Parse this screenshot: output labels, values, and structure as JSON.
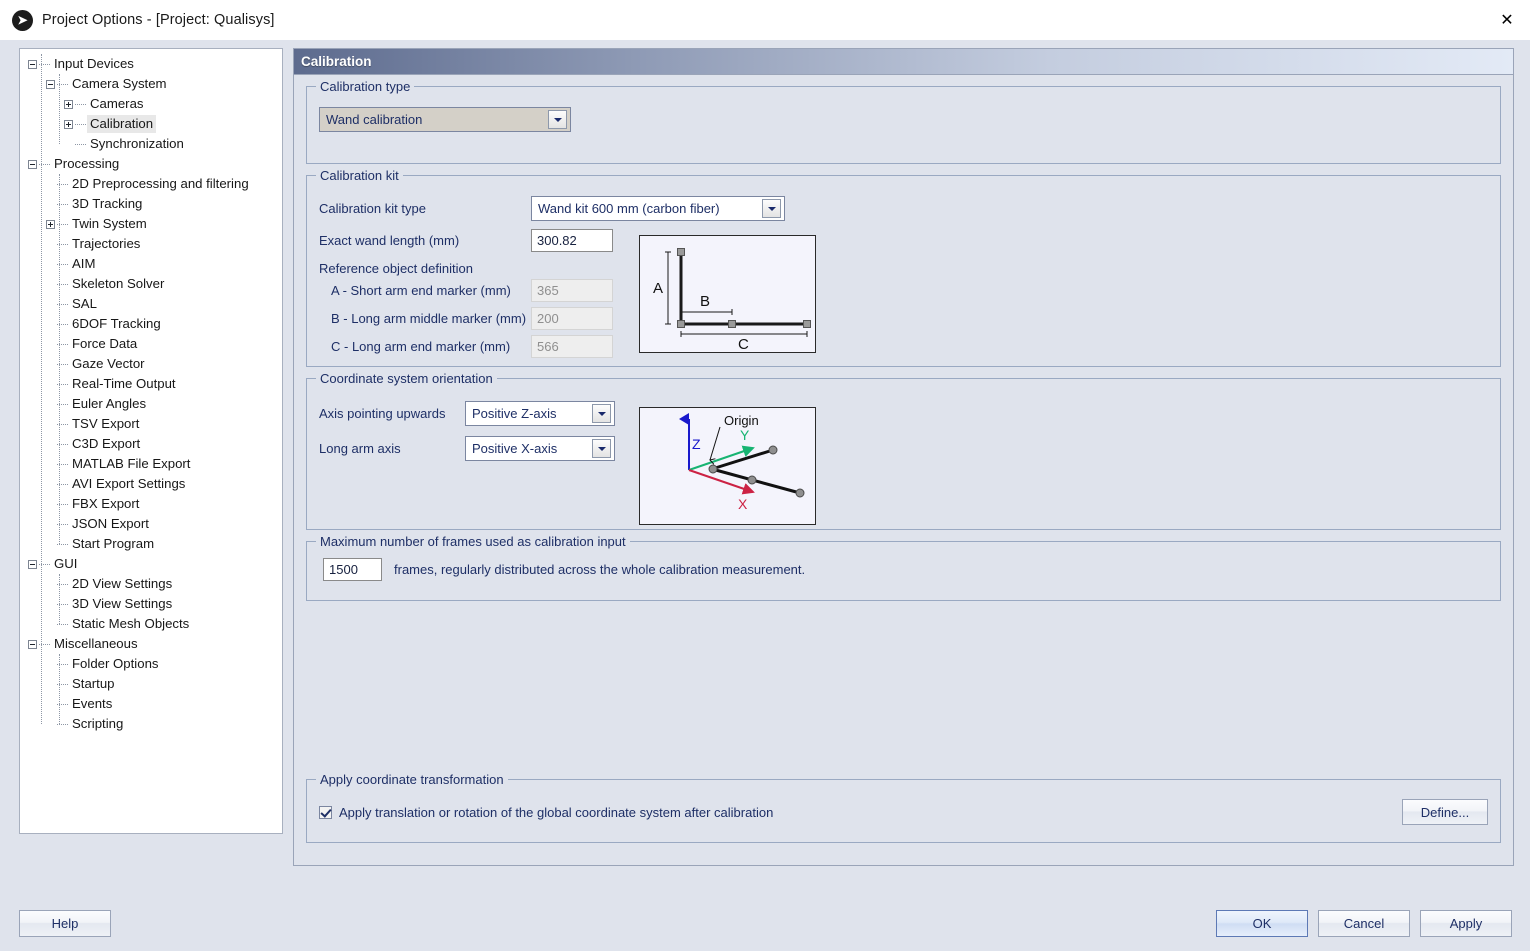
{
  "window": {
    "title": "Project Options - [Project: Qualisys]",
    "app_icon": "qualisys-logo-icon",
    "close_icon": "close-icon"
  },
  "sidebar": {
    "items": [
      {
        "label": "Input Devices",
        "depth": 0,
        "toggle": "minus",
        "selected": false
      },
      {
        "label": "Camera System",
        "depth": 1,
        "toggle": "minus",
        "selected": false
      },
      {
        "label": "Cameras",
        "depth": 2,
        "toggle": "plus",
        "selected": false
      },
      {
        "label": "Calibration",
        "depth": 2,
        "toggle": "plus",
        "selected": true
      },
      {
        "label": "Synchronization",
        "depth": 2,
        "toggle": "leaf",
        "selected": false
      },
      {
        "label": "Processing",
        "depth": 0,
        "toggle": "minus",
        "selected": false
      },
      {
        "label": "2D Preprocessing and filtering",
        "depth": 1,
        "toggle": "leaf",
        "selected": false
      },
      {
        "label": "3D Tracking",
        "depth": 1,
        "toggle": "leaf",
        "selected": false
      },
      {
        "label": "Twin System",
        "depth": 1,
        "toggle": "plus",
        "selected": false
      },
      {
        "label": "Trajectories",
        "depth": 1,
        "toggle": "leaf",
        "selected": false
      },
      {
        "label": "AIM",
        "depth": 1,
        "toggle": "leaf",
        "selected": false
      },
      {
        "label": "Skeleton Solver",
        "depth": 1,
        "toggle": "leaf",
        "selected": false
      },
      {
        "label": "SAL",
        "depth": 1,
        "toggle": "leaf",
        "selected": false
      },
      {
        "label": "6DOF Tracking",
        "depth": 1,
        "toggle": "leaf",
        "selected": false
      },
      {
        "label": "Force Data",
        "depth": 1,
        "toggle": "leaf",
        "selected": false
      },
      {
        "label": "Gaze Vector",
        "depth": 1,
        "toggle": "leaf",
        "selected": false
      },
      {
        "label": "Real-Time Output",
        "depth": 1,
        "toggle": "leaf",
        "selected": false
      },
      {
        "label": "Euler Angles",
        "depth": 1,
        "toggle": "leaf",
        "selected": false
      },
      {
        "label": "TSV Export",
        "depth": 1,
        "toggle": "leaf",
        "selected": false
      },
      {
        "label": "C3D Export",
        "depth": 1,
        "toggle": "leaf",
        "selected": false
      },
      {
        "label": "MATLAB File Export",
        "depth": 1,
        "toggle": "leaf",
        "selected": false
      },
      {
        "label": "AVI Export Settings",
        "depth": 1,
        "toggle": "leaf",
        "selected": false
      },
      {
        "label": "FBX Export",
        "depth": 1,
        "toggle": "leaf",
        "selected": false
      },
      {
        "label": "JSON Export",
        "depth": 1,
        "toggle": "leaf",
        "selected": false
      },
      {
        "label": "Start Program",
        "depth": 1,
        "toggle": "leaf",
        "selected": false
      },
      {
        "label": "GUI",
        "depth": 0,
        "toggle": "minus",
        "selected": false
      },
      {
        "label": "2D View Settings",
        "depth": 1,
        "toggle": "leaf",
        "selected": false
      },
      {
        "label": "3D View Settings",
        "depth": 1,
        "toggle": "leaf",
        "selected": false
      },
      {
        "label": "Static Mesh Objects",
        "depth": 1,
        "toggle": "leaf",
        "selected": false
      },
      {
        "label": "Miscellaneous",
        "depth": 0,
        "toggle": "minus",
        "selected": false
      },
      {
        "label": "Folder Options",
        "depth": 1,
        "toggle": "leaf",
        "selected": false
      },
      {
        "label": "Startup",
        "depth": 1,
        "toggle": "leaf",
        "selected": false
      },
      {
        "label": "Events",
        "depth": 1,
        "toggle": "leaf",
        "selected": false
      },
      {
        "label": "Scripting",
        "depth": 1,
        "toggle": "leaf",
        "selected": false
      }
    ]
  },
  "page": {
    "header_title": "Calibration",
    "calibration_type": {
      "legend": "Calibration type",
      "value": "Wand calibration"
    },
    "calibration_kit": {
      "legend": "Calibration kit",
      "kit_type_label": "Calibration kit type",
      "kit_type_value": "Wand kit 600 mm (carbon fiber)",
      "wand_length_label": "Exact wand length (mm)",
      "wand_length_value": "300.82",
      "reference_object_label": "Reference object definition",
      "ref_rows": [
        {
          "label": "A - Short arm end marker (mm)",
          "value": "365"
        },
        {
          "label": "B - Long arm middle marker (mm)",
          "value": "200"
        },
        {
          "label": "C - Long arm end marker (mm)",
          "value": "566"
        }
      ],
      "diagram_labels": {
        "a": "A",
        "b": "B",
        "c": "C"
      }
    },
    "coordinate_system": {
      "legend": "Coordinate system orientation",
      "axis_up_label": "Axis pointing upwards",
      "axis_up_value": "Positive Z-axis",
      "long_arm_label": "Long arm axis",
      "long_arm_value": "Positive X-axis",
      "diagram_labels": {
        "origin": "Origin",
        "z": "Z",
        "y": "Y",
        "x": "X"
      },
      "diagram_colors": {
        "z": "#1818cc",
        "y": "#17b472",
        "x": "#cc2244"
      }
    },
    "max_frames": {
      "legend": "Maximum number of frames used as calibration input",
      "value": "1500",
      "suffix": "frames, regularly distributed across the whole calibration measurement."
    },
    "apply_transform": {
      "legend": "Apply coordinate transformation",
      "checkbox_label": "Apply translation or rotation of the global coordinate system after calibration",
      "checkbox_checked": true,
      "define_button": "Define..."
    }
  },
  "footer": {
    "help": "Help",
    "ok": "OK",
    "cancel": "Cancel",
    "apply": "Apply"
  }
}
